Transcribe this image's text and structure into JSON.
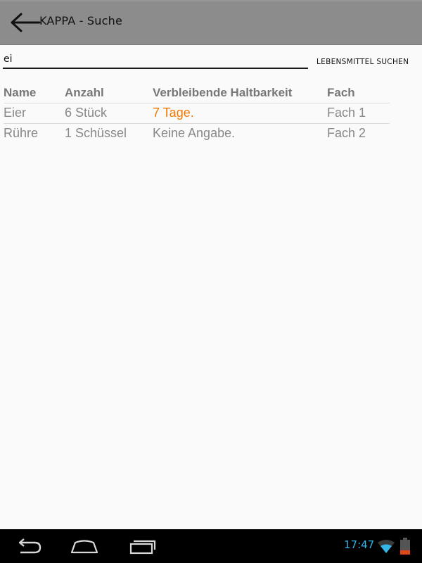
{
  "app_bar": {
    "title": "KAPPA - Suche"
  },
  "search": {
    "value": "ei",
    "button_label": "LEBENSMITTEL SUCHEN"
  },
  "table": {
    "headers": [
      "Name",
      "Anzahl",
      "Verbleibende Haltbarkeit",
      "Fach"
    ],
    "rows": [
      {
        "name": "Eier",
        "quantity": "6 Stück",
        "shelf_life": "7 Tage.",
        "shelf_life_warning": true,
        "compartment": "Fach 1"
      },
      {
        "name": "Rühre",
        "quantity": "1 Schüssel",
        "shelf_life": "Keine Angabe.",
        "shelf_life_warning": false,
        "compartment": "Fach 2"
      }
    ]
  },
  "status_bar": {
    "time": "17:47"
  },
  "colors": {
    "accent_time": "#33b5e5",
    "warning": "#ee7a00",
    "battery_low": "#e0471b"
  },
  "icons": {
    "back": "arrow-left-icon",
    "nav_back": "nav-back-icon",
    "nav_home": "nav-home-icon",
    "nav_recent": "nav-recent-apps-icon",
    "wifi": "wifi-icon",
    "battery": "battery-icon"
  }
}
